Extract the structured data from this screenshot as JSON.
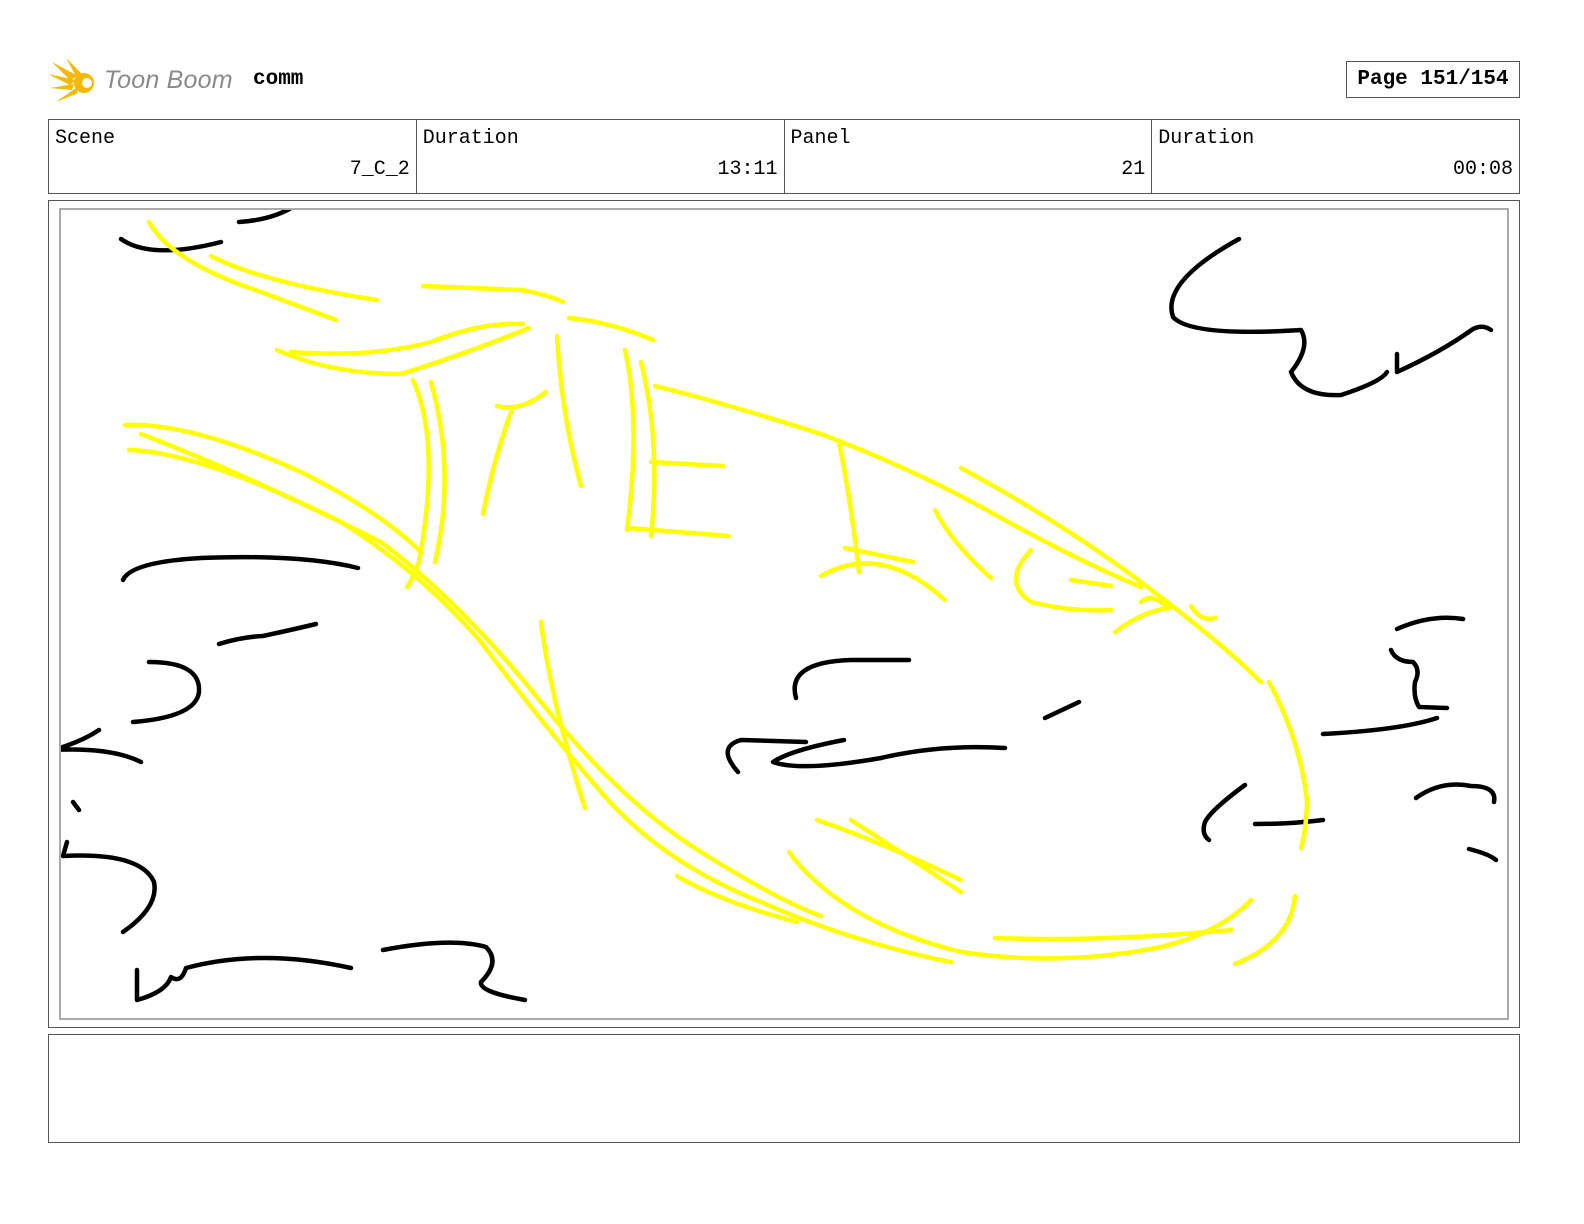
{
  "header": {
    "logo_text": "Toon Boom",
    "project_name": "comm",
    "page_label": "Page 151/154"
  },
  "info": {
    "scene_label": "Scene",
    "scene_value": "7_C_2",
    "scene_duration_label": "Duration",
    "scene_duration_value": "13:11",
    "panel_label": "Panel",
    "panel_value": "21",
    "panel_duration_label": "Duration",
    "panel_duration_value": "00:08"
  },
  "panel": {
    "drawing": "sketch",
    "stroke_colors": {
      "clouds": "#000000",
      "shape": "#ffff00"
    }
  },
  "notes": {
    "text": ""
  },
  "colors": {
    "logo_accent": "#f5b800",
    "logo_text": "#8a8a8a",
    "border": "#555555"
  }
}
